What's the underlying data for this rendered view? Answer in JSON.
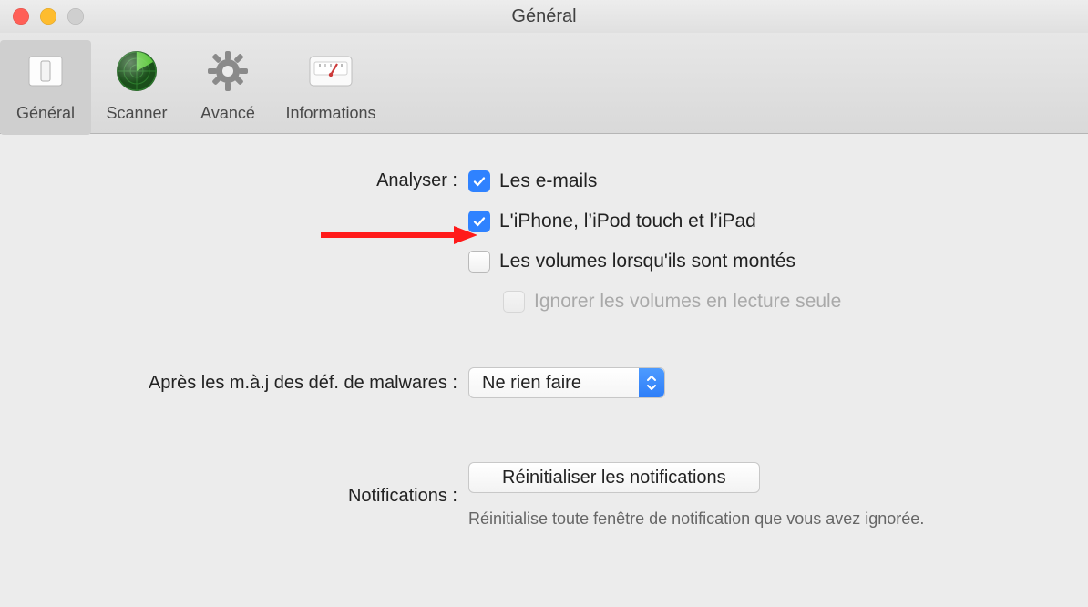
{
  "window": {
    "title": "Général"
  },
  "toolbar": {
    "items": [
      {
        "id": "general",
        "label": "Général",
        "selected": true
      },
      {
        "id": "scanner",
        "label": "Scanner",
        "selected": false
      },
      {
        "id": "advanced",
        "label": "Avancé",
        "selected": false
      },
      {
        "id": "info",
        "label": "Informations",
        "selected": false
      }
    ]
  },
  "analyze": {
    "label": "Analyser :",
    "options": [
      {
        "text": "Les e-mails",
        "checked": true,
        "disabled": false
      },
      {
        "text": "L'iPhone, l’iPod touch et l’iPad",
        "checked": true,
        "disabled": false,
        "highlighted": true
      },
      {
        "text": "Les volumes lorsqu'ils sont montés",
        "checked": false,
        "disabled": false
      },
      {
        "text": "Ignorer les volumes en lecture seule",
        "checked": false,
        "disabled": true,
        "indent": true
      }
    ]
  },
  "afterUpdate": {
    "label": "Après les m.à.j des déf. de malwares :",
    "selected": "Ne rien faire"
  },
  "notifications": {
    "label": "Notifications :",
    "button": "Réinitialiser les notifications",
    "helper": "Réinitialise toute fenêtre de notification que vous avez ignorée."
  }
}
